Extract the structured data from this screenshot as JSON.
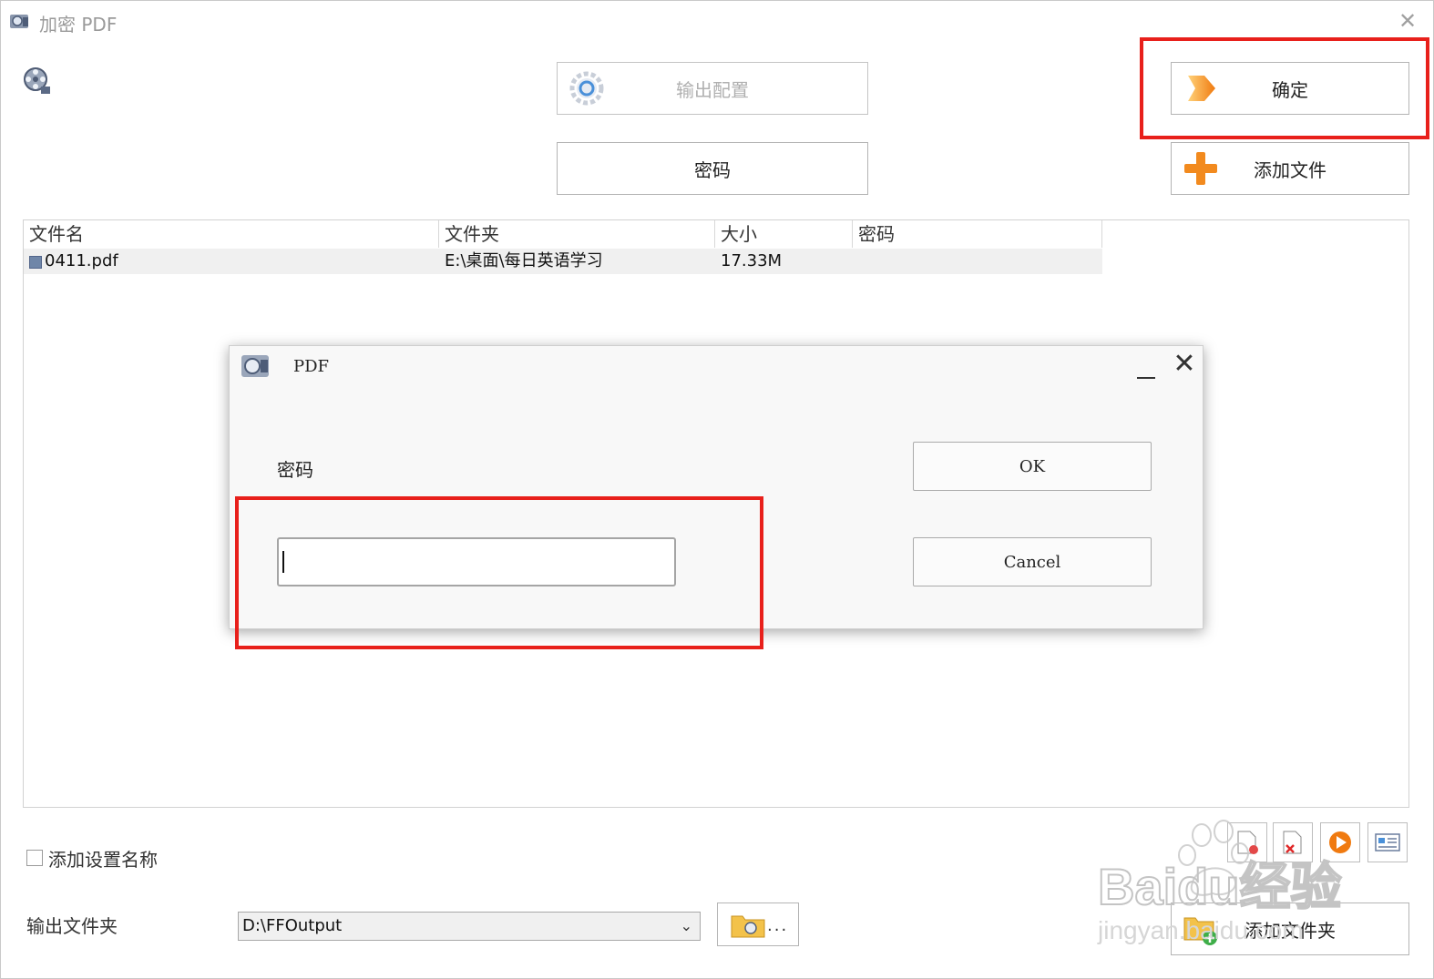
{
  "window": {
    "title": "加密 PDF"
  },
  "toolbar": {
    "output_config_label": "输出配置",
    "password_label": "密码",
    "confirm_label": "确定",
    "add_file_label": "添加文件"
  },
  "file_list": {
    "columns": [
      "文件名",
      "文件夹",
      "大小",
      "密码"
    ],
    "rows": [
      {
        "name": "0411.pdf",
        "folder": "E:\\桌面\\每日英语学习",
        "size": "17.33M",
        "password": ""
      }
    ]
  },
  "dialog": {
    "title": "PDF",
    "field_label": "密码",
    "input_value": "",
    "ok_label": "OK",
    "cancel_label": "Cancel"
  },
  "bottom": {
    "add_setting_name_label": "添加设置名称",
    "add_setting_name_checked": false,
    "output_folder_label": "输出文件夹",
    "output_folder_value": "D:\\FFOutput",
    "browse_label": "...",
    "add_folder_label": "添加文件夹"
  },
  "watermark": {
    "text": "Baidu经验",
    "subtext": "jingyan.baidu.com"
  },
  "colors": {
    "highlight": "#e8201b",
    "disabled_text": "#b0b0b0",
    "row_bg": "#f0f0f0"
  },
  "icons": [
    "app-title-icon",
    "film-reel-icon",
    "gear-icon",
    "arrow-right-icon",
    "plus-icon",
    "pdf-file-icon",
    "folder-icon",
    "remove-icon",
    "delete-icon",
    "play-icon",
    "info-icon",
    "add-folder-icon"
  ]
}
